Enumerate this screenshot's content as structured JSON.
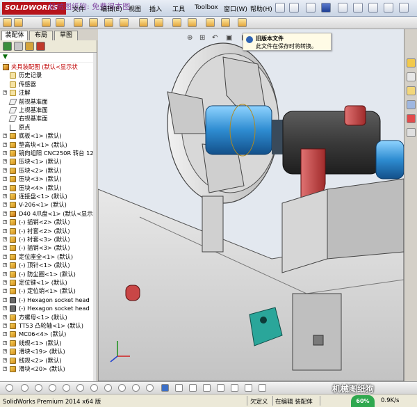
{
  "app": {
    "brand": "SOLIDWORKS",
    "overlay_text": "机械图纸狗: 免费得本图"
  },
  "menu": {
    "items": [
      "文件",
      "编辑(E)",
      "视图",
      "插入",
      "工具",
      "Toolbox",
      "窗口(W)",
      "帮助(H)"
    ]
  },
  "tabs": [
    "装配体",
    "布局",
    "草图"
  ],
  "tooltip": {
    "title": "旧版本文件",
    "body": "此文件在保存时将转换。"
  },
  "tree": {
    "root": "夹具装配图  (默认<显示状",
    "items": [
      {
        "label": "历史记录",
        "icon": "history-icon",
        "exp": ""
      },
      {
        "label": "传感器",
        "icon": "sensor-icon",
        "exp": ""
      },
      {
        "label": "注解",
        "icon": "annotation-icon",
        "exp": "+"
      },
      {
        "label": "前视基准面",
        "icon": "plane-icon",
        "exp": ""
      },
      {
        "label": "上视基准面",
        "icon": "plane-icon",
        "exp": ""
      },
      {
        "label": "右视基准面",
        "icon": "plane-icon",
        "exp": ""
      },
      {
        "label": "原点",
        "icon": "origin-icon",
        "exp": ""
      },
      {
        "label": "底板<1> (默认)",
        "icon": "part-icon",
        "exp": "+"
      },
      {
        "label": "垫高块<1> (默认)",
        "icon": "part-icon",
        "exp": "+"
      },
      {
        "label": "镜向组阳 CNC250R 转台 12",
        "icon": "part-icon",
        "exp": "+"
      },
      {
        "label": "压块<1> (默认)",
        "icon": "part-icon",
        "exp": "+"
      },
      {
        "label": "压块<2> (默认)",
        "icon": "part-icon",
        "exp": "+"
      },
      {
        "label": "压块<3> (默认)",
        "icon": "part-icon",
        "exp": "+"
      },
      {
        "label": "压块<4> (默认)",
        "icon": "part-icon",
        "exp": "+"
      },
      {
        "label": "连接盘<1> (默认)",
        "icon": "part-icon",
        "exp": "+"
      },
      {
        "label": "V-206<1> (默认)",
        "icon": "part-icon",
        "exp": "+"
      },
      {
        "label": "D40 4爪盘<1> (默认<显示状",
        "icon": "assembly-icon",
        "exp": "+"
      },
      {
        "label": "(-) 插销<2> (默认)",
        "icon": "part-icon",
        "exp": "+"
      },
      {
        "label": "(-) 衬套<2> (默认)",
        "icon": "part-icon",
        "exp": "+"
      },
      {
        "label": "(-) 衬套<3> (默认)",
        "icon": "part-icon",
        "exp": "+"
      },
      {
        "label": "(-) 插销<3> (默认)",
        "icon": "part-icon",
        "exp": "+"
      },
      {
        "label": "定位座全<1> (默认)",
        "icon": "part-icon",
        "exp": "+"
      },
      {
        "label": "(-) 顶针<1> (默认)",
        "icon": "part-icon",
        "exp": "+"
      },
      {
        "label": "(-) 防尘圈<1> (默认)",
        "icon": "part-icon",
        "exp": "+"
      },
      {
        "label": "定位键<1> (默认)",
        "icon": "part-icon",
        "exp": "+"
      },
      {
        "label": "(-) 定位销<1> (默认)",
        "icon": "part-icon",
        "exp": "+"
      },
      {
        "label": "(-) Hexagon socket head",
        "icon": "screw-icon",
        "exp": "+"
      },
      {
        "label": "(-) Hexagon socket head",
        "icon": "screw-icon",
        "exp": "+"
      },
      {
        "label": "方螺母<1> (默认)",
        "icon": "part-icon",
        "exp": "+"
      },
      {
        "label": "TT53 凸轮轴<1> (默认)",
        "icon": "part-icon",
        "exp": "+"
      },
      {
        "label": "MC06<4> (默认)",
        "icon": "part-icon",
        "exp": "+"
      },
      {
        "label": "线规<1> (默认)",
        "icon": "part-icon",
        "exp": "+"
      },
      {
        "label": "滑块<19> (默认)",
        "icon": "part-icon",
        "exp": "+"
      },
      {
        "label": "线规<2> (默认)",
        "icon": "part-icon",
        "exp": "+"
      },
      {
        "label": "滑块<20> (默认)",
        "icon": "part-icon",
        "exp": "+"
      }
    ]
  },
  "status": {
    "app_version": "SolidWorks Premium 2014 x64 版",
    "state": "欠定义",
    "mode": "在编辑 装配体",
    "speed": "60%",
    "net": "0.9K/s"
  },
  "watermark": "机械图纸狗"
}
